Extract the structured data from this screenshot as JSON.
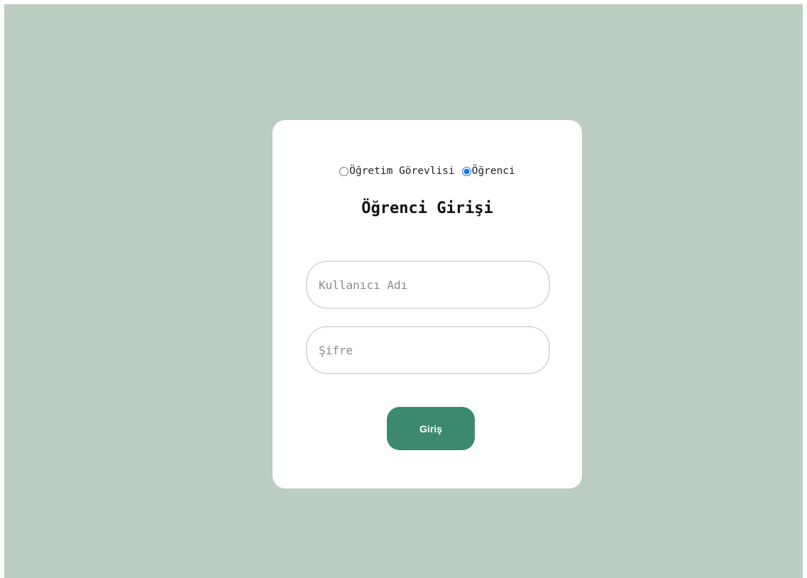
{
  "login": {
    "roles": [
      {
        "label": "Öğretim Görevlisi",
        "selected": false
      },
      {
        "label": "Öğrenci",
        "selected": true
      }
    ],
    "title": "Öğrenci Girişi",
    "username_placeholder": "Kullanıcı Adı",
    "password_placeholder": "Şifre",
    "submit_label": "Giriş"
  },
  "colors": {
    "background": "#bacdc0",
    "card": "#ffffff",
    "button": "#3b8a6e",
    "radio_accent": "#1a73e8"
  }
}
